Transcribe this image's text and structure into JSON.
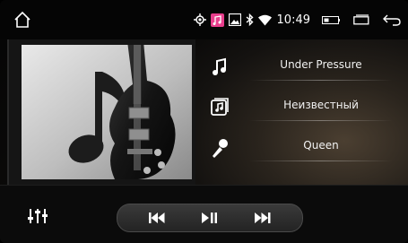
{
  "status_bar": {
    "time": "10:49",
    "icons": [
      "home-icon",
      "location-icon",
      "music-app-icon",
      "image-icon",
      "bluetooth-icon",
      "wifi-icon",
      "battery-icon",
      "recent-apps-icon",
      "back-icon"
    ],
    "accent_music_icon_color": "#e83e8c"
  },
  "track": {
    "title": "Under Pressure",
    "album": "Неизвестный",
    "artist": "Queen"
  },
  "controls": {
    "icons": [
      "equalizer-icon",
      "previous-icon",
      "play-pause-icon",
      "next-icon"
    ]
  }
}
